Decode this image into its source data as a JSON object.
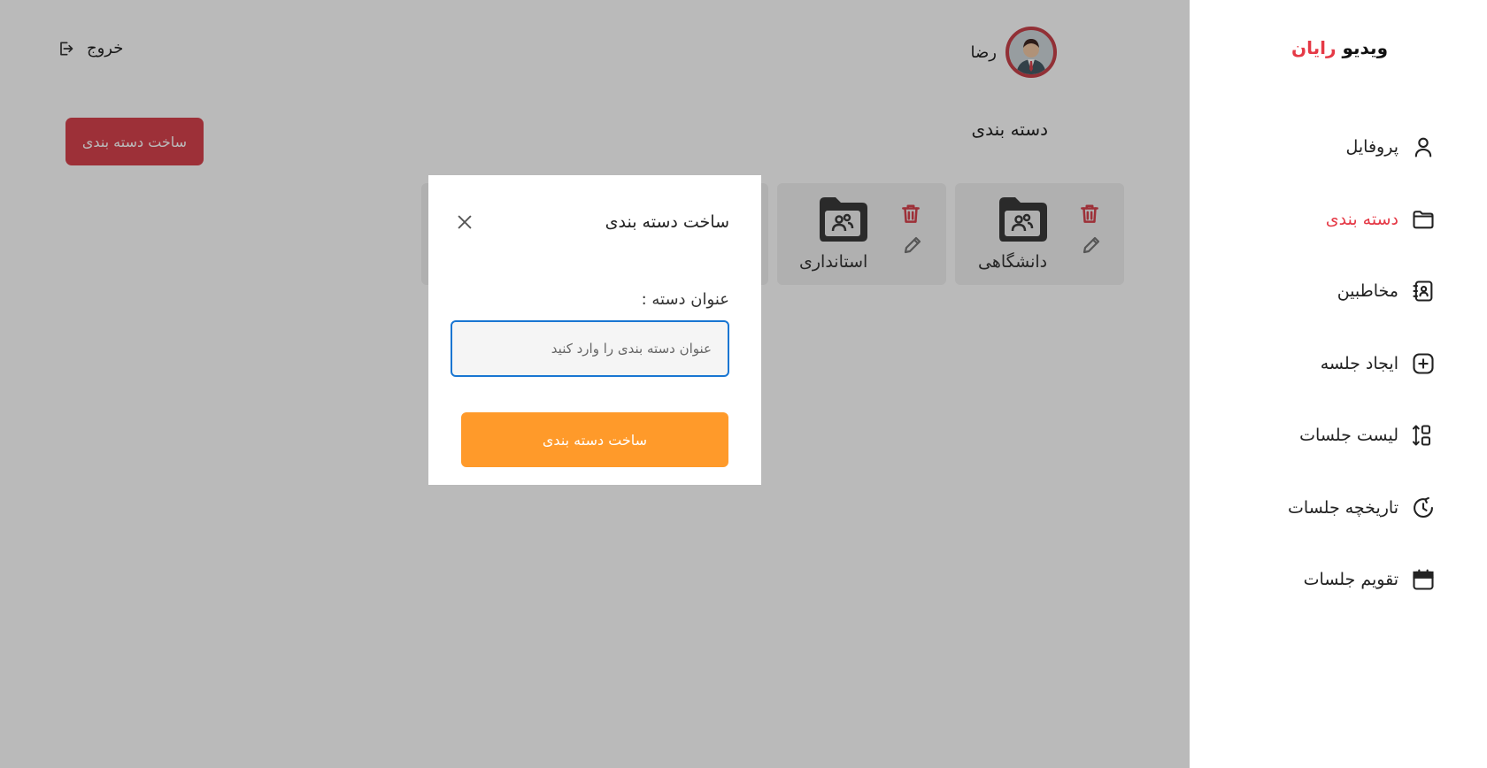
{
  "header": {
    "logout_label": "خروج",
    "user_name": "رضا"
  },
  "page": {
    "title": "دسته بندی",
    "create_button": "ساخت دسته بندی"
  },
  "categories": [
    {
      "label": "دانشگاهی"
    },
    {
      "label": "استانداری"
    }
  ],
  "modal": {
    "title": "ساخت دسته بندی",
    "field_label": "عنوان دسته :",
    "input_placeholder": "عنوان دسته بندی را وارد کنید",
    "input_value": "",
    "submit_label": "ساخت دسته بندی"
  },
  "sidebar": {
    "logo_part1": "ویدیو",
    "logo_part2": "رایان",
    "items": [
      {
        "label": "پروفایل",
        "icon": "user-icon",
        "active": false
      },
      {
        "label": "دسته بندی",
        "icon": "folder-icon",
        "active": true
      },
      {
        "label": "مخاطبین",
        "icon": "contacts-book-icon",
        "active": false
      },
      {
        "label": "ایجاد جلسه",
        "icon": "plus-square-icon",
        "active": false
      },
      {
        "label": "لیست جلسات",
        "icon": "sort-list-icon",
        "active": false
      },
      {
        "label": "تاریخچه جلسات",
        "icon": "history-icon",
        "active": false
      },
      {
        "label": "تقویم جلسات",
        "icon": "calendar-icon",
        "active": false
      }
    ]
  },
  "colors": {
    "accent_red": "#e53946",
    "create_button_red": "#d8424d",
    "submit_orange": "#ff9a2a",
    "input_border_blue": "#1976d2",
    "overlay": "rgba(0,0,0,0.27)"
  }
}
